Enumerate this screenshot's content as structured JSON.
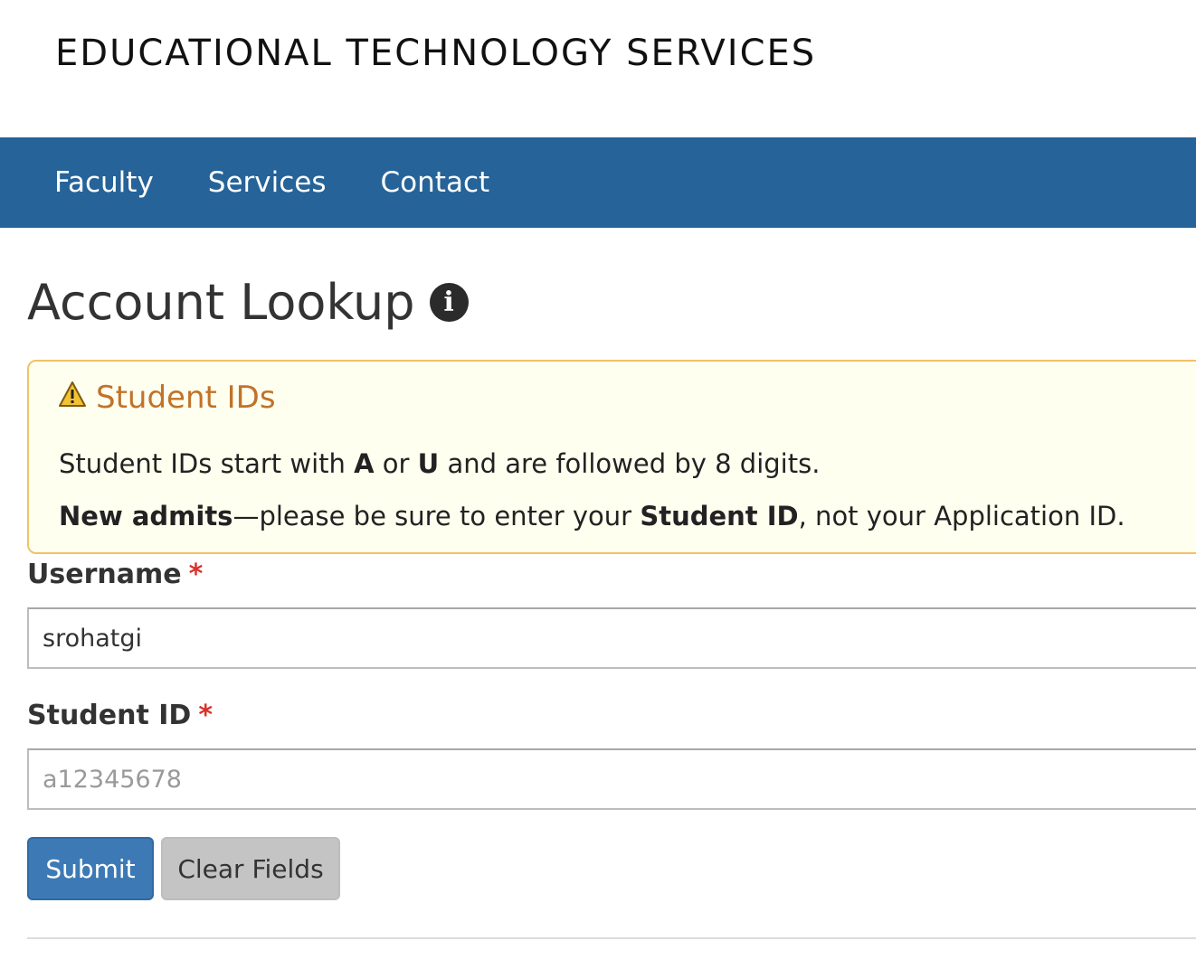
{
  "header": {
    "site_title": "EDUCATIONAL TECHNOLOGY SERVICES"
  },
  "nav": {
    "items": [
      {
        "label": "Faculty"
      },
      {
        "label": "Services"
      },
      {
        "label": "Contact"
      }
    ]
  },
  "page": {
    "title": "Account Lookup",
    "info_icon": "info-circle-icon"
  },
  "alert": {
    "icon": "warning-triangle-icon",
    "title": "Student IDs",
    "line1": {
      "t1": "Student IDs start with ",
      "b1": "A",
      "t2": " or ",
      "b2": "U",
      "t3": " and are followed by 8 digits."
    },
    "line2": {
      "b1": "New admits",
      "t1": "—please be sure to enter your ",
      "b2": "Student ID",
      "t2": ", not your Application ID."
    },
    "colors": {
      "background": "#fffff0",
      "border": "#f0c266",
      "title": "#c0732a"
    }
  },
  "form": {
    "username": {
      "label": "Username",
      "required_mark": "*",
      "value": "srohatgi"
    },
    "student_id": {
      "label": "Student ID",
      "required_mark": "*",
      "placeholder": "a12345678",
      "value": ""
    },
    "submit_label": "Submit",
    "clear_label": "Clear Fields"
  },
  "colors": {
    "nav_bg": "#266398",
    "submit_bg": "#3d7ab5",
    "required": "#d9322a"
  }
}
